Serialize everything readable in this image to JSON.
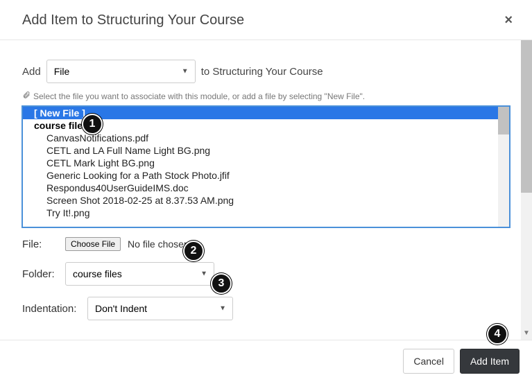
{
  "header": {
    "title": "Add Item to Structuring Your Course",
    "close_label": "×"
  },
  "add_row": {
    "prefix": "Add",
    "type_value": "File",
    "suffix": "to Structuring Your Course"
  },
  "hint": "Select the file you want to associate with this module, or add a file by selecting \"New File\".",
  "file_list": {
    "new_file": "[ New File ]",
    "folder": "course files",
    "files": [
      "CanvasNotifications.pdf",
      "CETL and LA Full Name Light BG.png",
      "CETL Mark Light BG.png",
      "Generic Looking for a Path Stock Photo.jfif",
      "Respondus40UserGuideIMS.doc",
      "Screen Shot 2018-02-25 at 8.37.53 AM.png",
      "Try It!.png"
    ]
  },
  "file_row": {
    "label": "File:",
    "button": "Choose File",
    "status": "No file chosen"
  },
  "folder_row": {
    "label": "Folder:",
    "value": "course files"
  },
  "indent_row": {
    "label": "Indentation:",
    "value": "Don't Indent"
  },
  "footer": {
    "cancel": "Cancel",
    "add": "Add Item"
  },
  "callouts": {
    "c1": "1",
    "c2": "2",
    "c3": "3",
    "c4": "4"
  }
}
